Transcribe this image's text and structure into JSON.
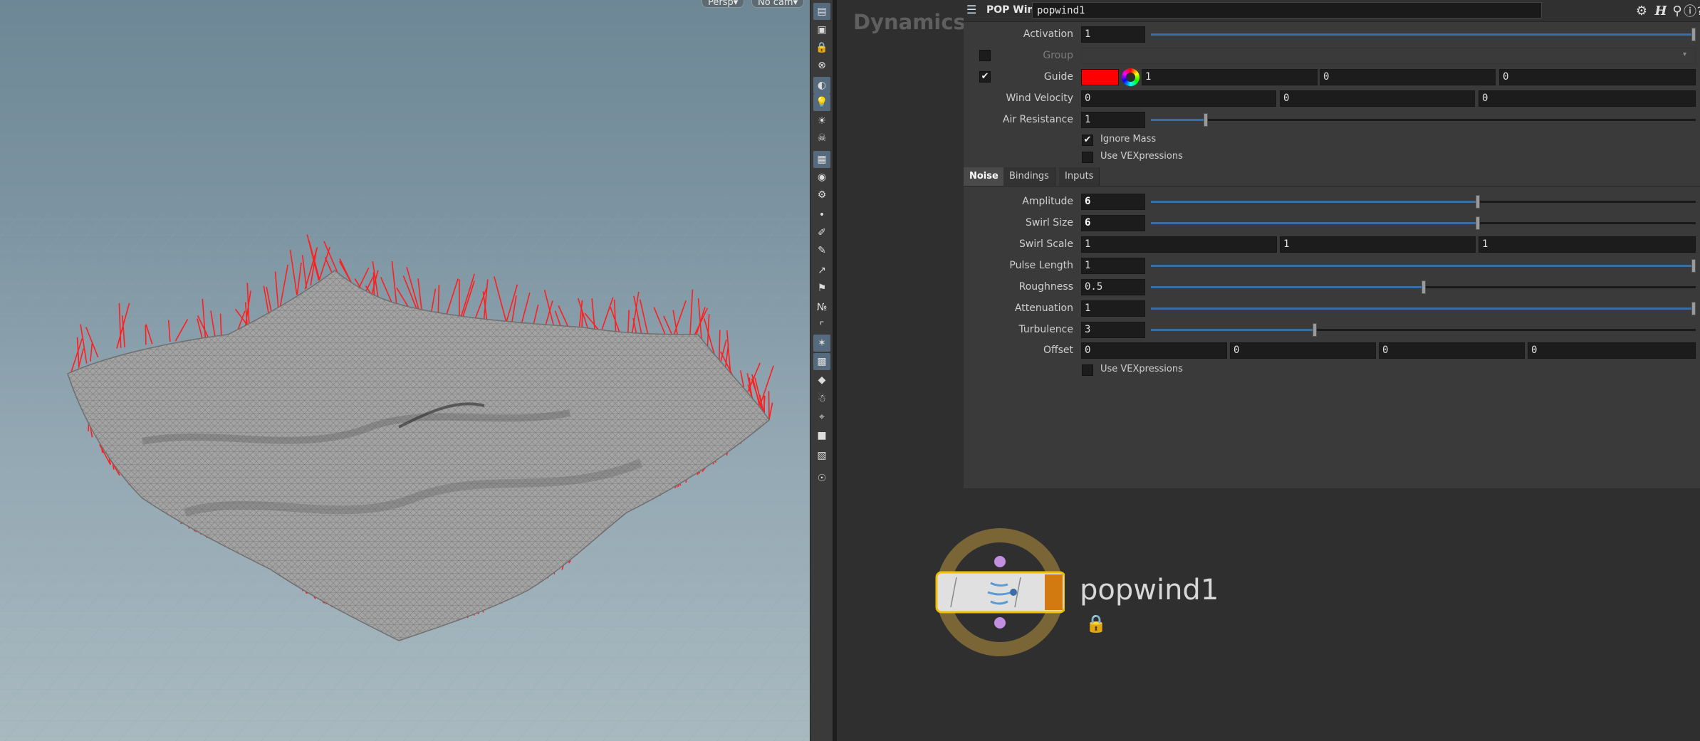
{
  "viewport": {
    "camera_menu": "Persp▾",
    "cam_menu": "No cam▾"
  },
  "toolbar_icons": [
    "selection-icon",
    "box-icon",
    "lock-icon",
    "ghost-icon",
    "shading-icon",
    "light-icon",
    "light-bulb-icon",
    "skull-icon",
    "display-icon",
    "camera-icon",
    "camera-tools-icon",
    "point-icon",
    "brush-icon",
    "pen-icon",
    "vector-12-icon",
    "flag-icon",
    "label-12-icon",
    "corner-icon",
    "wire-icon",
    "texture-icon",
    "diamond-icon",
    "monkey-icon",
    "axis-icon",
    "cube-icon",
    "background-icon",
    "lightbulb-guide-icon"
  ],
  "network": {
    "context_label": "Dynamics",
    "node_name": "popwind1"
  },
  "params": {
    "op_type": "POP Wind",
    "op_name": "popwind1",
    "activation": {
      "label": "Activation",
      "value": "1",
      "fraction": 1.0
    },
    "group": {
      "label": "Group",
      "value": ""
    },
    "guide": {
      "label": "Guide",
      "color": "#ff0000",
      "v1": "1",
      "v2": "0",
      "v3": "0"
    },
    "wind_velocity": {
      "label": "Wind Velocity",
      "x": "0",
      "y": "0",
      "z": "0"
    },
    "air_resistance": {
      "label": "Air Resistance",
      "value": "1",
      "fraction": 0.1
    },
    "ignore_mass": {
      "label": "Ignore Mass",
      "checked": true
    },
    "use_vex_top": {
      "label": "Use VEXpressions",
      "checked": false
    },
    "tabs": [
      "Noise",
      "Bindings",
      "Inputs"
    ],
    "amplitude": {
      "label": "Amplitude",
      "value": "6",
      "fraction": 0.6
    },
    "swirl_size": {
      "label": "Swirl Size",
      "value": "6",
      "fraction": 0.6
    },
    "swirl_scale": {
      "label": "Swirl Scale",
      "x": "1",
      "y": "1",
      "z": "1"
    },
    "pulse_length": {
      "label": "Pulse Length",
      "value": "1",
      "fraction": 1.0
    },
    "roughness": {
      "label": "Roughness",
      "value": "0.5",
      "fraction": 0.5
    },
    "attenuation": {
      "label": "Attenuation",
      "value": "1",
      "fraction": 1.0
    },
    "turbulence": {
      "label": "Turbulence",
      "value": "3",
      "fraction": 0.3
    },
    "offset": {
      "label": "Offset",
      "a": "0",
      "b": "0",
      "c": "0",
      "d": "0"
    },
    "use_vex_bottom": {
      "label": "Use VEXpressions",
      "checked": false
    }
  }
}
